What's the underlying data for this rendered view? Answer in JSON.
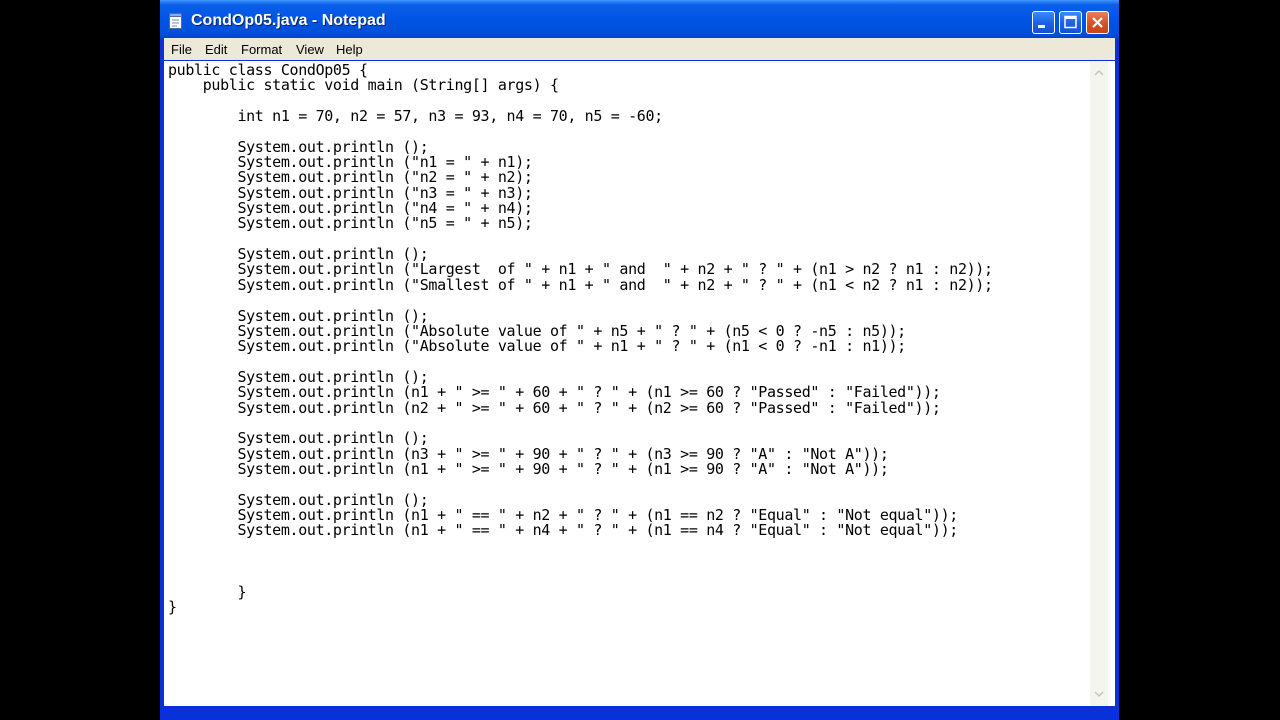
{
  "window": {
    "title": "CondOp05.java - Notepad"
  },
  "menu": [
    "File",
    "Edit",
    "Format",
    "View",
    "Help"
  ],
  "editor": {
    "lines": [
      "public class CondOp05 {",
      "    public static void main (String[] args) {",
      "",
      "        int n1 = 70, n2 = 57, n3 = 93, n4 = 70, n5 = -60;",
      "",
      "        System.out.println ();",
      "        System.out.println (\"n1 = \" + n1);",
      "        System.out.println (\"n2 = \" + n2);",
      "        System.out.println (\"n3 = \" + n3);",
      "        System.out.println (\"n4 = \" + n4);",
      "        System.out.println (\"n5 = \" + n5);",
      "",
      "        System.out.println ();",
      "        System.out.println (\"Largest  of \" + n1 + \" and  \" + n2 + \" ? \" + (n1 > n2 ? n1 : n2));",
      "        System.out.println (\"Smallest of \" + n1 + \" and  \" + n2 + \" ? \" + (n1 < n2 ? n1 : n2));",
      "",
      "        System.out.println ();",
      "        System.out.println (\"Absolute value of \" + n5 + \" ? \" + (n5 < 0 ? -n5 : n5));",
      "        System.out.println (\"Absolute value of \" + n1 + \" ? \" + (n1 < 0 ? -n1 : n1));",
      "",
      "        System.out.println ();",
      "        System.out.println (n1 + \" >= \" + 60 + \" ? \" + (n1 >= 60 ? \"Passed\" : \"Failed\"));",
      "        System.out.println (n2 + \" >= \" + 60 + \" ? \" + (n2 >= 60 ? \"Passed\" : \"Failed\"));",
      "",
      "        System.out.println ();",
      "        System.out.println (n3 + \" >= \" + 90 + \" ? \" + (n3 >= 90 ? \"A\" : \"Not A\"));",
      "        System.out.println (n1 + \" >= \" + 90 + \" ? \" + (n1 >= 90 ? \"A\" : \"Not A\"));",
      "",
      "        System.out.println ();",
      "        System.out.println (n1 + \" == \" + n2 + \" ? \" + (n1 == n2 ? \"Equal\" : \"Not equal\"));",
      "        System.out.println (n1 + \" == \" + n4 + \" ? \" + (n1 == n4 ? \"Equal\" : \"Not equal\"));",
      "",
      "",
      "",
      "        }",
      "}"
    ]
  },
  "colors": {
    "titlebar": "#0054e3",
    "frame": "#0831d9",
    "menubar": "#ece9d8",
    "close_button": "#d9532a"
  }
}
